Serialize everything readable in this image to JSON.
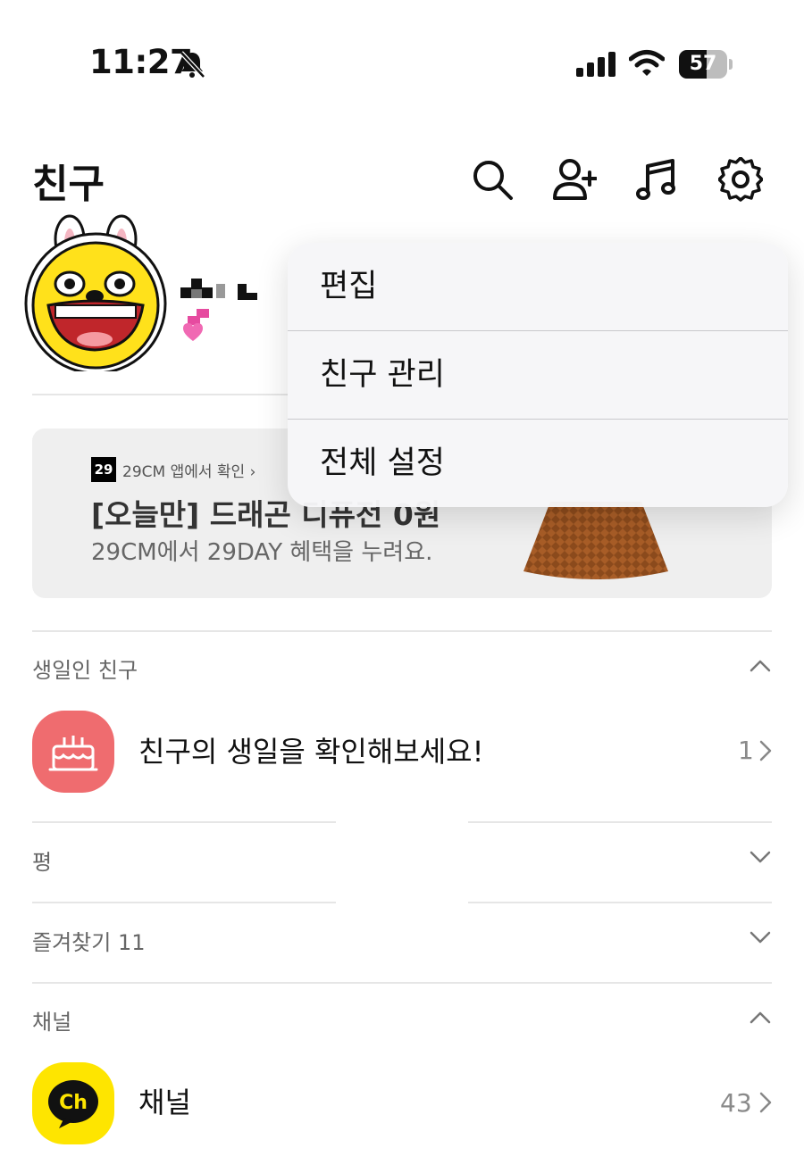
{
  "status_bar": {
    "time": "11:27",
    "battery": "57",
    "battery_level": 0.57,
    "icons": [
      "bell-slash-icon",
      "cellular-signal-icon",
      "wifi-icon",
      "battery-icon"
    ]
  },
  "header": {
    "title": "친구",
    "icons": [
      "search-icon",
      "add-friend-icon",
      "music-icon",
      "gear-icon"
    ]
  },
  "banner": {
    "logo": "29",
    "kicker": "29CM 앱에서 확인",
    "title": "[오늘만] 드래곤 디퓨전 0원",
    "subtitle": "29CM에서 29DAY 혜택을 누려요."
  },
  "menu": {
    "items": [
      {
        "label": "편집"
      },
      {
        "label": "친구 관리"
      },
      {
        "label": "전체 설정"
      }
    ]
  },
  "sections": {
    "birthday": {
      "label": "생일인 친구",
      "row_text": "친구의 생일을 확인해보세요!",
      "count": "1"
    },
    "pyeong": {
      "label": "평"
    },
    "favorites": {
      "label": "즐겨찾기 11"
    },
    "channel": {
      "label": "채널",
      "row_text": "채널",
      "count": "43",
      "icon_text": "Ch"
    }
  },
  "colors": {
    "birthday_icon": "#ef6c6f",
    "channel_icon": "#fee500",
    "banner_bg": "#efefef",
    "menu_bg": "#f6f6f8"
  }
}
